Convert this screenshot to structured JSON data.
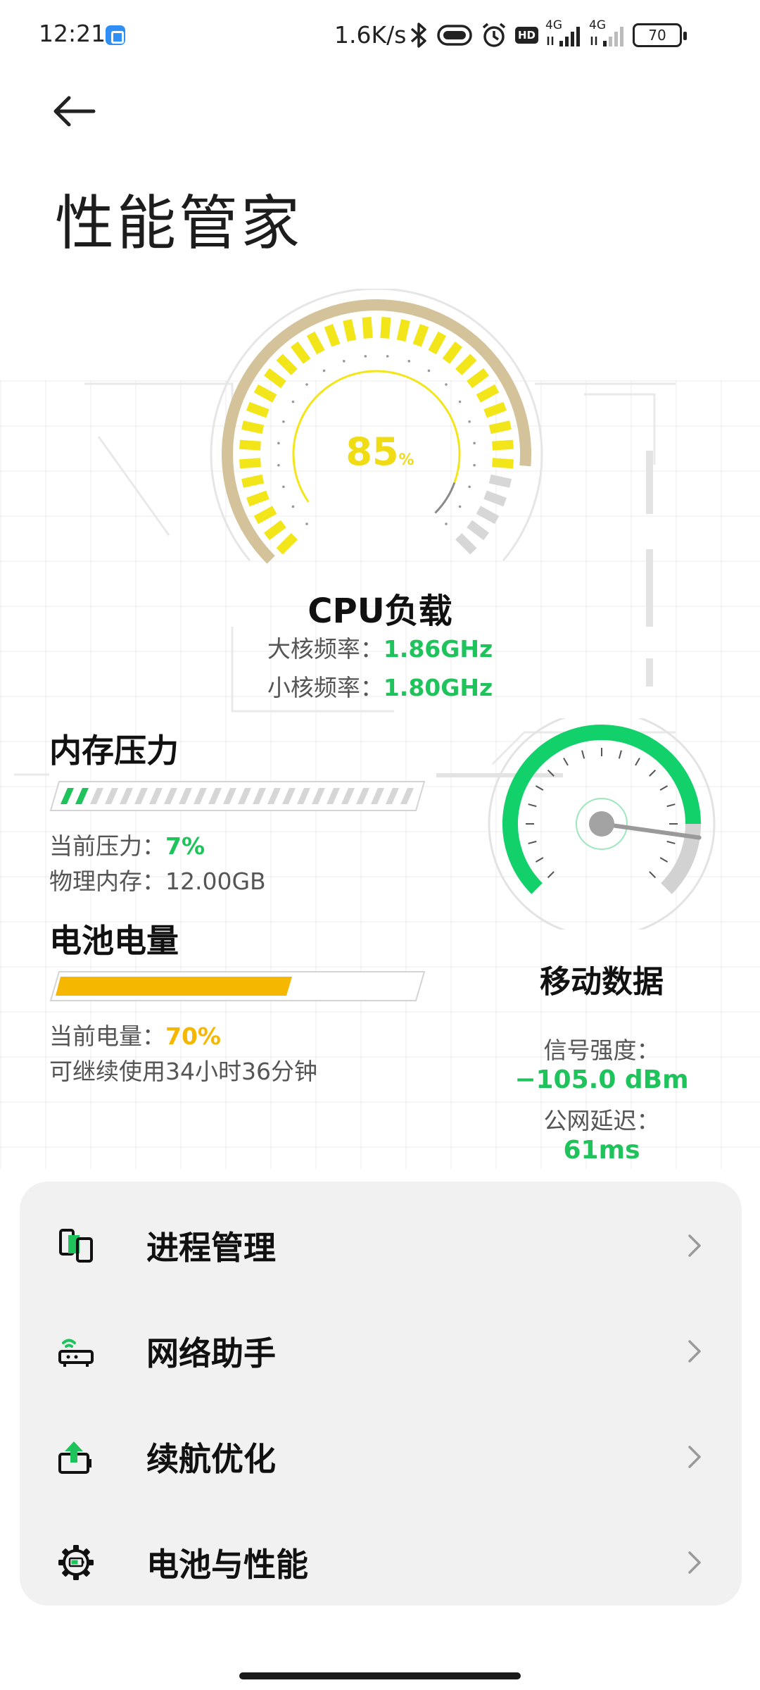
{
  "status_bar": {
    "time": "12:21",
    "net_speed": "1.6K/s",
    "hd_badge": "HD",
    "sim1_type": "4G",
    "sim2_type": "4G",
    "battery_level": "70"
  },
  "header": {
    "back_icon": "back-arrow-icon",
    "title": "性能管家"
  },
  "cpu": {
    "load_value": "85",
    "load_unit": "%",
    "load_fraction": 0.85,
    "title": "CPU负载",
    "big_core_label": "大核频率：",
    "big_core_value": "1.86GHz",
    "small_core_label": "小核频率：",
    "small_core_value": "1.80GHz",
    "accent_color": "#f2e61a",
    "track_color": "#d4c29a"
  },
  "memory": {
    "title": "内存压力",
    "pressure_label": "当前压力：",
    "pressure_value": "7%",
    "pressure_fraction": 0.07,
    "physical_label": "物理内存：",
    "physical_value": "12.00GB",
    "accent_color": "#1fc35c"
  },
  "battery": {
    "title": "电池电量",
    "level_label": "当前电量：",
    "level_value": "70%",
    "level_fraction": 0.7,
    "remaining_text": "可继续使用34小时36分钟",
    "accent_color": "#f5b700"
  },
  "network": {
    "title": "移动数据",
    "signal_label": "信号强度：",
    "signal_value": "−105.0 dBm",
    "latency_label": "公网延迟：",
    "latency_value": "61ms",
    "accent_color": "#12d06a"
  },
  "menu": {
    "items": [
      {
        "label": "进程管理",
        "icon": "process-icon"
      },
      {
        "label": "网络助手",
        "icon": "router-icon"
      },
      {
        "label": "续航优化",
        "icon": "battery-boost-icon"
      },
      {
        "label": "电池与性能",
        "icon": "gear-battery-icon"
      }
    ]
  }
}
